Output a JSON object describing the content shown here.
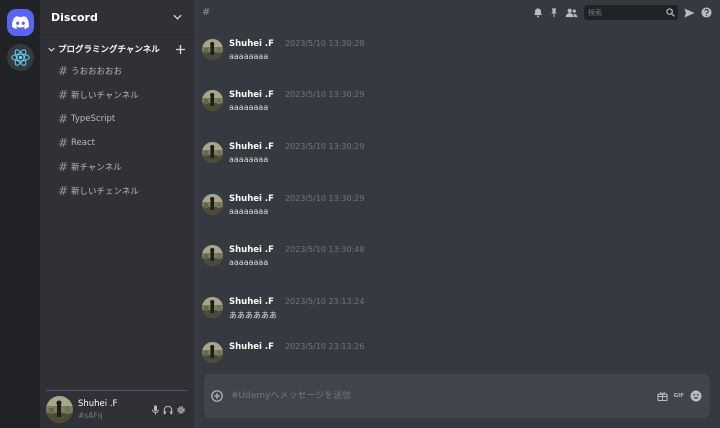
{
  "server": {
    "name": "Discord",
    "category_label": "プログラミングチャンネル"
  },
  "channels": [
    {
      "label": "うおおおおお"
    },
    {
      "label": "新しいチャンネル"
    },
    {
      "label": "TypeScript"
    },
    {
      "label": "React"
    },
    {
      "label": "新チャンネル"
    },
    {
      "label": "新しいチェンネル"
    }
  ],
  "user": {
    "name": "Shuhei .F",
    "tag": "#sAFq"
  },
  "topbar": {
    "channel_hash": "#",
    "search_placeholder": "検索"
  },
  "messages": [
    {
      "author": "Shuhei .F",
      "timestamp": "2023/5/10 13:30:28",
      "text": "aaaaaaaa"
    },
    {
      "author": "Shuhei .F",
      "timestamp": "2023/5/10 13:30:29",
      "text": "aaaaaaaa"
    },
    {
      "author": "Shuhei .F",
      "timestamp": "2023/5/10 13:30:29",
      "text": "aaaaaaaa"
    },
    {
      "author": "Shuhei .F",
      "timestamp": "2023/5/10 13:30:29",
      "text": "aaaaaaaa"
    },
    {
      "author": "Shuhei .F",
      "timestamp": "2023/5/10 13:30:48",
      "text": "aaaaaaaa"
    },
    {
      "author": "Shuhei .F",
      "timestamp": "2023/5/10 23:13:24",
      "text": "ああああああ"
    },
    {
      "author": "Shuhei .F",
      "timestamp": "2023/5/10 23:13:26",
      "text": ""
    }
  ],
  "composer": {
    "placeholder": "#Udemyへメッセージを送信",
    "gif_label": "GIF"
  },
  "icons": {
    "server_rail": [
      "discord-logo-icon",
      "react-logo-icon"
    ],
    "header": [
      "chevron-down-icon"
    ],
    "category": [
      "chevron-down-icon",
      "plus-icon"
    ],
    "channel": "hash-icon",
    "user_controls": [
      "microphone-icon",
      "headphones-icon",
      "gear-icon"
    ],
    "topbar": [
      "bell-icon",
      "pin-icon",
      "members-icon",
      "search-icon",
      "send-icon",
      "help-icon"
    ],
    "composer": [
      "add-circle-icon",
      "gift-icon",
      "gif-icon",
      "emoji-icon"
    ]
  },
  "colors": {
    "rail_bg": "#202225",
    "sidebar_bg": "#2f3136",
    "main_bg": "#36393f",
    "composer_bg": "#40444b",
    "brand": "#5865f2",
    "react_accent": "#61dafb"
  }
}
